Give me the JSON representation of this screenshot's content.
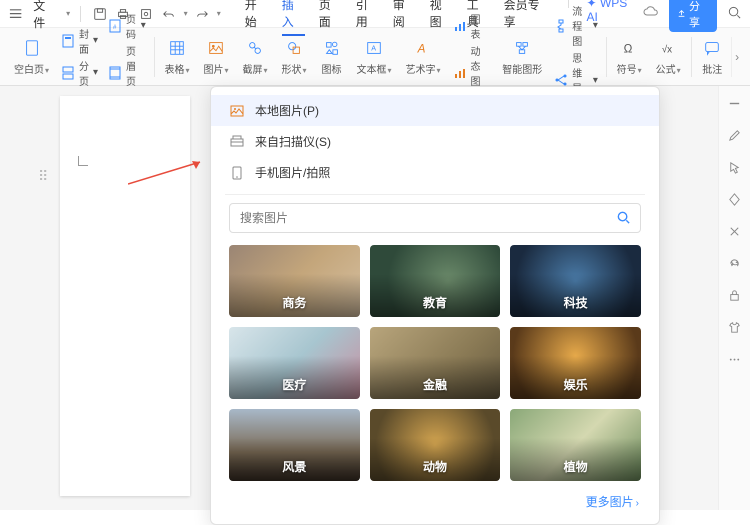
{
  "menubar": {
    "file_label": "文件",
    "tabs": [
      "开始",
      "插入",
      "页面",
      "引用",
      "审阅",
      "视图",
      "工具",
      "会员专享"
    ],
    "active_tab_index": 1,
    "ai_label": "WPS AI",
    "share_label": "分享"
  },
  "ribbon": {
    "blank_page": "空白页",
    "cover": "封面",
    "page_break": "分页",
    "page_number": "页码",
    "header_footer": "页眉页脚",
    "table": "表格",
    "picture": "图片",
    "screenshot": "截屏",
    "shape": "形状",
    "icon": "图标",
    "textbox": "文本框",
    "wordart": "艺术字",
    "chart": "图表",
    "dyn_chart": "动态图表",
    "smart_shape": "智能图形",
    "flowchart": "流程图",
    "mindmap": "思维导图",
    "symbol": "符号",
    "equation": "公式",
    "comment": "批注"
  },
  "dropdown": {
    "local_image": "本地图片(P)",
    "from_scanner": "来自扫描仪(S)",
    "phone_photo": "手机图片/拍照",
    "search_placeholder": "搜索图片",
    "categories": [
      {
        "key": "business",
        "label": "商务"
      },
      {
        "key": "education",
        "label": "教育"
      },
      {
        "key": "tech",
        "label": "科技"
      },
      {
        "key": "medical",
        "label": "医疗"
      },
      {
        "key": "finance",
        "label": "金融"
      },
      {
        "key": "entertain",
        "label": "娱乐"
      },
      {
        "key": "landscape",
        "label": "风景"
      },
      {
        "key": "animal",
        "label": "动物"
      },
      {
        "key": "plant",
        "label": "植物"
      }
    ],
    "more_label": "更多图片"
  },
  "sidebar_icons": [
    "minus",
    "pencil",
    "cursor",
    "diamond",
    "scissors",
    "refresh",
    "lock",
    "tshirt",
    "more"
  ]
}
